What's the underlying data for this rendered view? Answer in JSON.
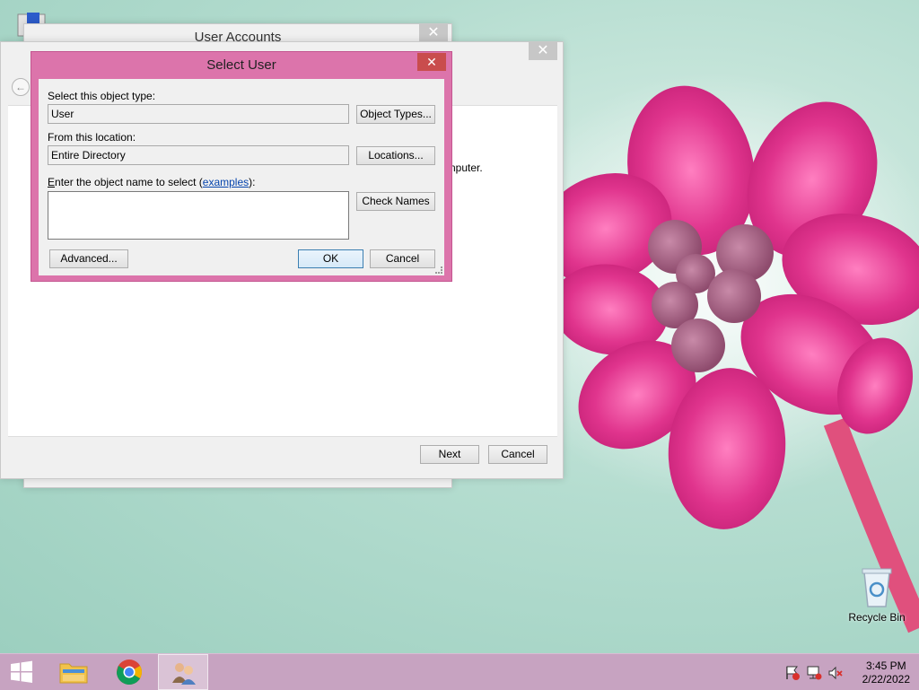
{
  "desktop": {
    "recycle_bin_label": "Recycle Bin"
  },
  "back_window": {
    "title": "User Accounts",
    "close_glyph": "✕"
  },
  "wizard_window": {
    "close_glyph": "✕",
    "text_fragment": "nputer.",
    "next_label": "Next",
    "cancel_label": "Cancel"
  },
  "select_user": {
    "title": "Select User",
    "close_glyph": "✕",
    "object_type_label": "Select this object type:",
    "object_type_value": "User",
    "object_types_button": "Object Types...",
    "location_label": "From this location:",
    "location_value": "Entire Directory",
    "locations_button": "Locations...",
    "object_name_label_prefix": "E",
    "object_name_label_rest": "nter the object name to select (",
    "examples_link": "examples",
    "object_name_label_suffix": "):",
    "object_name_value": "",
    "check_names_button": "Check Names",
    "advanced_button": "Advanced...",
    "ok_button": "OK",
    "cancel_button": "Cancel"
  },
  "taskbar": {
    "time": "3:45 PM",
    "date": "2/22/2022",
    "items": [
      "start",
      "file-explorer",
      "chrome",
      "user-accounts"
    ]
  },
  "colors": {
    "accent_pink": "#d9659e",
    "taskbar": "#c7a3c1",
    "desktop": "#b5ddd0"
  }
}
